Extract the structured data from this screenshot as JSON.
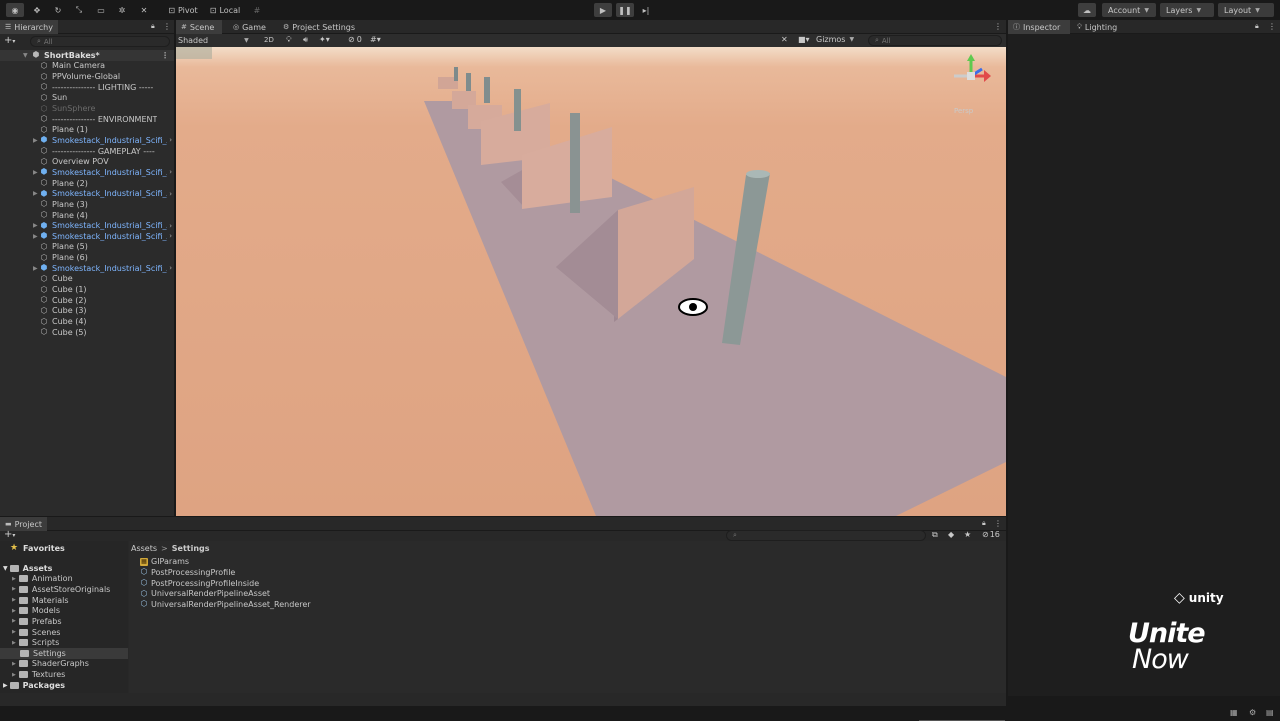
{
  "toolbar": {
    "pivot_label": "Pivot",
    "local_label": "Local",
    "account_label": "Account",
    "layers_label": "Layers",
    "layout_label": "Layout"
  },
  "hierarchy": {
    "tab_label": "Hierarchy",
    "search_placeholder": "All",
    "scene_name": "ShortBakes*",
    "items": [
      {
        "label": "Main Camera",
        "type": "object"
      },
      {
        "label": "PPVolume-Global",
        "type": "object"
      },
      {
        "label": "--------------- LIGHTING -----",
        "type": "object"
      },
      {
        "label": "Sun",
        "type": "object"
      },
      {
        "label": "SunSphere",
        "type": "disabled"
      },
      {
        "label": "--------------- ENVIRONMENT",
        "type": "object"
      },
      {
        "label": "Plane (1)",
        "type": "object"
      },
      {
        "label": "Smokestack_Industrial_Scifi_A",
        "type": "prefab"
      },
      {
        "label": "--------------- GAMEPLAY ----",
        "type": "object"
      },
      {
        "label": "Overview POV",
        "type": "object"
      },
      {
        "label": "Smokestack_Industrial_Scifi_A",
        "type": "prefab"
      },
      {
        "label": "Plane (2)",
        "type": "object"
      },
      {
        "label": "Smokestack_Industrial_Scifi_A",
        "type": "prefab"
      },
      {
        "label": "Plane (3)",
        "type": "object"
      },
      {
        "label": "Plane (4)",
        "type": "object"
      },
      {
        "label": "Smokestack_Industrial_Scifi_A",
        "type": "prefab"
      },
      {
        "label": "Smokestack_Industrial_Scifi_A",
        "type": "prefab"
      },
      {
        "label": "Plane (5)",
        "type": "object"
      },
      {
        "label": "Plane (6)",
        "type": "object"
      },
      {
        "label": "Smokestack_Industrial_Scifi_A",
        "type": "prefab"
      },
      {
        "label": "Cube",
        "type": "object"
      },
      {
        "label": "Cube (1)",
        "type": "object"
      },
      {
        "label": "Cube (2)",
        "type": "object"
      },
      {
        "label": "Cube (3)",
        "type": "object"
      },
      {
        "label": "Cube (4)",
        "type": "object"
      },
      {
        "label": "Cube (5)",
        "type": "object"
      }
    ]
  },
  "scene": {
    "tabs": [
      "Scene",
      "Game",
      "Project Settings"
    ],
    "shading_mode": "Shaded",
    "mode_2d": "2D",
    "hidden_count": "0",
    "gizmos_label": "Gizmos",
    "search_placeholder": "All",
    "gizmo_label": "Persp",
    "colors": {
      "sky": "#f3ddc8",
      "ground": "#dea382",
      "platform": "#b59aa2",
      "block": "#d4a89b"
    }
  },
  "inspector": {
    "tabs": [
      "Inspector",
      "Lighting"
    ]
  },
  "project": {
    "tab_label": "Project",
    "favorites_label": "Favorites",
    "assets_label": "Assets",
    "folders": [
      "Animation",
      "AssetStoreOriginals",
      "Materials",
      "Models",
      "Prefabs",
      "Scenes",
      "Scripts",
      "Settings",
      "ShaderGraphs",
      "Textures"
    ],
    "packages_label": "Packages",
    "selected_folder": "Settings",
    "breadcrumb": [
      "Assets",
      "Settings"
    ],
    "breadcrumb_sep": ">",
    "files": [
      "GIParams",
      "PostProcessingProfile",
      "PostProcessingProfileInside",
      "UniversalRenderPipelineAsset",
      "UniversalRenderPipelineAsset_Renderer"
    ],
    "hidden_count": "16"
  },
  "branding": {
    "logo_text": "unity",
    "line1": "Unite",
    "line2": "Now"
  }
}
